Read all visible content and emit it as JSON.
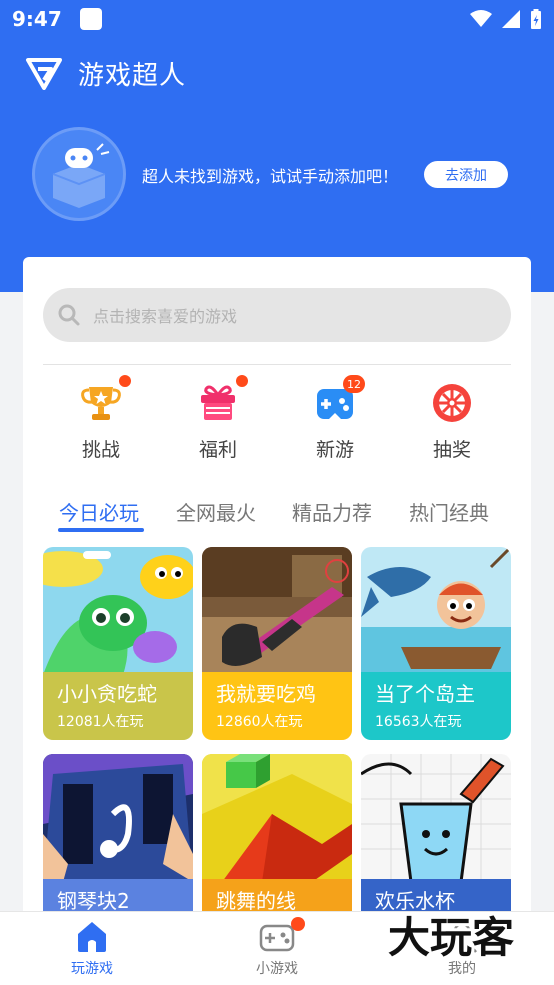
{
  "status_bar": {
    "time": "9:47"
  },
  "app": {
    "title": "游戏超人"
  },
  "empty_state": {
    "message": "超人未找到游戏，试试手动添加吧！",
    "button": "去添加"
  },
  "search": {
    "placeholder": "点击搜索喜爱的游戏"
  },
  "quick_actions": [
    {
      "label": "挑战",
      "icon": "trophy-icon",
      "badge": "dot"
    },
    {
      "label": "福利",
      "icon": "gift-icon",
      "badge": "dot"
    },
    {
      "label": "新游",
      "icon": "gamepad-icon",
      "badge": "12"
    },
    {
      "label": "抽奖",
      "icon": "lottery-wheel-icon",
      "badge": ""
    }
  ],
  "tabs": [
    "今日必玩",
    "全网最火",
    "精品力荐",
    "热门经典"
  ],
  "active_tab": "今日必玩",
  "games": [
    {
      "name": "小小贪吃蛇",
      "players": "12081人在玩",
      "color": "#c9c54a"
    },
    {
      "name": "我就要吃鸡",
      "players": "12860人在玩",
      "color": "#ffc414"
    },
    {
      "name": "当了个岛主",
      "players": "16563人在玩",
      "color": "#1dc7c9"
    },
    {
      "name": "钢琴块2",
      "players": "",
      "color": "#5b82e0"
    },
    {
      "name": "跳舞的线",
      "players": "",
      "color": "#f5a21a"
    },
    {
      "name": "欢乐水杯",
      "players": "",
      "color": "#3564c8"
    }
  ],
  "bottom_nav": [
    {
      "label": "玩游戏",
      "icon": "home-icon",
      "active": true
    },
    {
      "label": "小游戏",
      "icon": "gamepad-icon",
      "active": false
    },
    {
      "label": "我的",
      "icon": "profile-icon",
      "active": false
    }
  ],
  "watermark": {
    "text": "大玩客"
  },
  "colors": {
    "primary": "#2f6ef2",
    "badge": "#ff4a1a"
  }
}
